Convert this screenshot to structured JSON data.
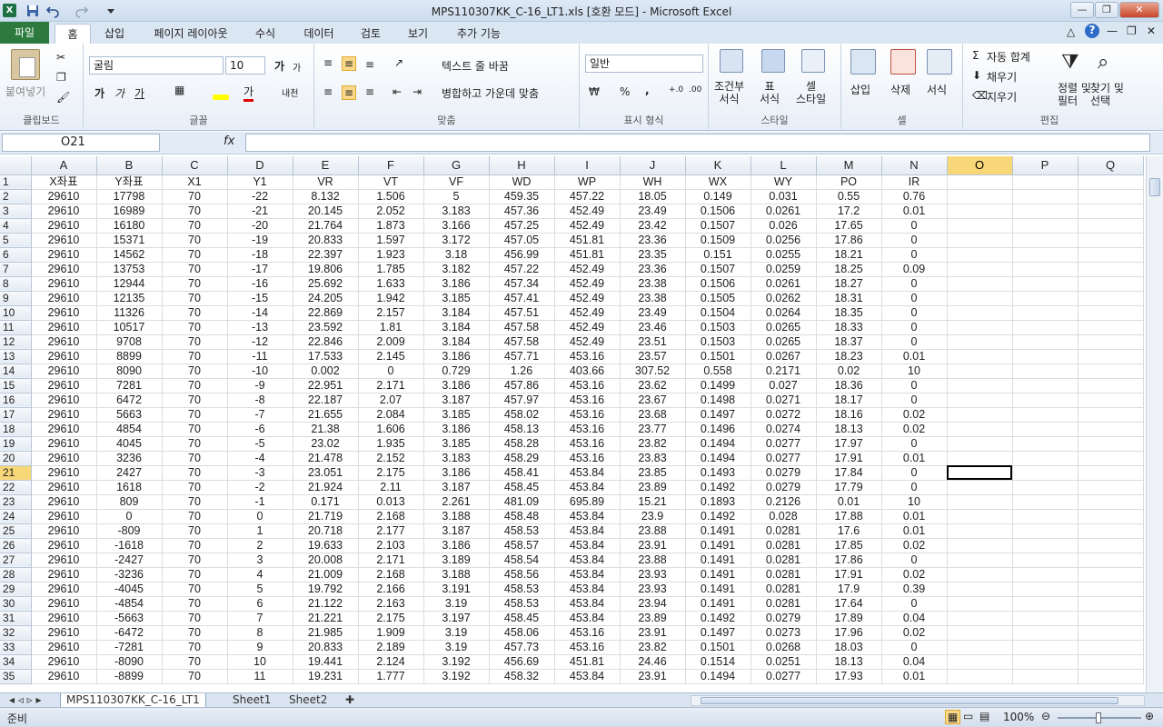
{
  "window": {
    "title": "MPS110307KK_C-16_LT1.xls  [호환 모드]  -  Microsoft Excel",
    "app_icon": "X"
  },
  "tabs": [
    "파일",
    "홈",
    "삽입",
    "페이지 레이아웃",
    "수식",
    "데이터",
    "검토",
    "보기",
    "추가 기능"
  ],
  "ribbon": {
    "clipboard": {
      "paste": "붙여넣기",
      "label": "클립보드"
    },
    "font": {
      "name": "굴림",
      "size": "10",
      "grow": "가",
      "shrink": "가",
      "bold": "가",
      "italic": "가",
      "underline": "가",
      "color_a": "가",
      "phonetic": "내천",
      "label": "글꼴"
    },
    "align": {
      "wrap": "텍스트 줄 바꿈",
      "merge": "병합하고 가운데 맞춤",
      "label": "맞춤"
    },
    "number": {
      "format": "일반",
      "percent": "%",
      "comma": ",",
      "label": "표시 형식"
    },
    "styles": {
      "cond": "조건부\n서식",
      "table": "표\n서식",
      "cell": "셀\n스타일",
      "label": "스타일"
    },
    "cells": {
      "insert": "삽입",
      "delete": "삭제",
      "format": "서식",
      "label": "셀"
    },
    "edit": {
      "autosum": "자동 합계",
      "fill": "채우기",
      "clear": "지우기",
      "sort": "정렬 및\n필터",
      "find": "찾기 및\n선택",
      "label": "편집"
    }
  },
  "formula_bar": {
    "name_box": "O21",
    "fx": "fx",
    "formula": ""
  },
  "columns": [
    "A",
    "B",
    "C",
    "D",
    "E",
    "F",
    "G",
    "H",
    "I",
    "J",
    "K",
    "L",
    "M",
    "N",
    "O",
    "P",
    "Q"
  ],
  "selected_cell": {
    "col": "O",
    "row": "21"
  },
  "rows": [
    [
      "1",
      "X좌표",
      "Y좌표",
      "X1",
      "Y1",
      "VR",
      "VT",
      "VF",
      "WD",
      "WP",
      "WH",
      "WX",
      "WY",
      "PO",
      "IR"
    ],
    [
      "2",
      "29610",
      "17798",
      "70",
      "-22",
      "8.132",
      "1.506",
      "5",
      "459.35",
      "457.22",
      "18.05",
      "0.149",
      "0.031",
      "0.55",
      "0.76"
    ],
    [
      "3",
      "29610",
      "16989",
      "70",
      "-21",
      "20.145",
      "2.052",
      "3.183",
      "457.36",
      "452.49",
      "23.49",
      "0.1506",
      "0.0261",
      "17.2",
      "0.01"
    ],
    [
      "4",
      "29610",
      "16180",
      "70",
      "-20",
      "21.764",
      "1.873",
      "3.166",
      "457.25",
      "452.49",
      "23.42",
      "0.1507",
      "0.026",
      "17.65",
      "0"
    ],
    [
      "5",
      "29610",
      "15371",
      "70",
      "-19",
      "20.833",
      "1.597",
      "3.172",
      "457.05",
      "451.81",
      "23.36",
      "0.1509",
      "0.0256",
      "17.86",
      "0"
    ],
    [
      "6",
      "29610",
      "14562",
      "70",
      "-18",
      "22.397",
      "1.923",
      "3.18",
      "456.99",
      "451.81",
      "23.35",
      "0.151",
      "0.0255",
      "18.21",
      "0"
    ],
    [
      "7",
      "29610",
      "13753",
      "70",
      "-17",
      "19.806",
      "1.785",
      "3.182",
      "457.22",
      "452.49",
      "23.36",
      "0.1507",
      "0.0259",
      "18.25",
      "0.09"
    ],
    [
      "8",
      "29610",
      "12944",
      "70",
      "-16",
      "25.692",
      "1.633",
      "3.186",
      "457.34",
      "452.49",
      "23.38",
      "0.1506",
      "0.0261",
      "18.27",
      "0"
    ],
    [
      "9",
      "29610",
      "12135",
      "70",
      "-15",
      "24.205",
      "1.942",
      "3.185",
      "457.41",
      "452.49",
      "23.38",
      "0.1505",
      "0.0262",
      "18.31",
      "0"
    ],
    [
      "10",
      "29610",
      "11326",
      "70",
      "-14",
      "22.869",
      "2.157",
      "3.184",
      "457.51",
      "452.49",
      "23.49",
      "0.1504",
      "0.0264",
      "18.35",
      "0"
    ],
    [
      "11",
      "29610",
      "10517",
      "70",
      "-13",
      "23.592",
      "1.81",
      "3.184",
      "457.58",
      "452.49",
      "23.46",
      "0.1503",
      "0.0265",
      "18.33",
      "0"
    ],
    [
      "12",
      "29610",
      "9708",
      "70",
      "-12",
      "22.846",
      "2.009",
      "3.184",
      "457.58",
      "452.49",
      "23.51",
      "0.1503",
      "0.0265",
      "18.37",
      "0"
    ],
    [
      "13",
      "29610",
      "8899",
      "70",
      "-11",
      "17.533",
      "2.145",
      "3.186",
      "457.71",
      "453.16",
      "23.57",
      "0.1501",
      "0.0267",
      "18.23",
      "0.01"
    ],
    [
      "14",
      "29610",
      "8090",
      "70",
      "-10",
      "0.002",
      "0",
      "0.729",
      "1.26",
      "403.66",
      "307.52",
      "0.558",
      "0.2171",
      "0.02",
      "10"
    ],
    [
      "15",
      "29610",
      "7281",
      "70",
      "-9",
      "22.951",
      "2.171",
      "3.186",
      "457.86",
      "453.16",
      "23.62",
      "0.1499",
      "0.027",
      "18.36",
      "0"
    ],
    [
      "16",
      "29610",
      "6472",
      "70",
      "-8",
      "22.187",
      "2.07",
      "3.187",
      "457.97",
      "453.16",
      "23.67",
      "0.1498",
      "0.0271",
      "18.17",
      "0"
    ],
    [
      "17",
      "29610",
      "5663",
      "70",
      "-7",
      "21.655",
      "2.084",
      "3.185",
      "458.02",
      "453.16",
      "23.68",
      "0.1497",
      "0.0272",
      "18.16",
      "0.02"
    ],
    [
      "18",
      "29610",
      "4854",
      "70",
      "-6",
      "21.38",
      "1.606",
      "3.186",
      "458.13",
      "453.16",
      "23.77",
      "0.1496",
      "0.0274",
      "18.13",
      "0.02"
    ],
    [
      "19",
      "29610",
      "4045",
      "70",
      "-5",
      "23.02",
      "1.935",
      "3.185",
      "458.28",
      "453.16",
      "23.82",
      "0.1494",
      "0.0277",
      "17.97",
      "0"
    ],
    [
      "20",
      "29610",
      "3236",
      "70",
      "-4",
      "21.478",
      "2.152",
      "3.183",
      "458.29",
      "453.16",
      "23.83",
      "0.1494",
      "0.0277",
      "17.91",
      "0.01"
    ],
    [
      "21",
      "29610",
      "2427",
      "70",
      "-3",
      "23.051",
      "2.175",
      "3.186",
      "458.41",
      "453.84",
      "23.85",
      "0.1493",
      "0.0279",
      "17.84",
      "0"
    ],
    [
      "22",
      "29610",
      "1618",
      "70",
      "-2",
      "21.924",
      "2.11",
      "3.187",
      "458.45",
      "453.84",
      "23.89",
      "0.1492",
      "0.0279",
      "17.79",
      "0"
    ],
    [
      "23",
      "29610",
      "809",
      "70",
      "-1",
      "0.171",
      "0.013",
      "2.261",
      "481.09",
      "695.89",
      "15.21",
      "0.1893",
      "0.2126",
      "0.01",
      "10"
    ],
    [
      "24",
      "29610",
      "0",
      "70",
      "0",
      "21.719",
      "2.168",
      "3.188",
      "458.48",
      "453.84",
      "23.9",
      "0.1492",
      "0.028",
      "17.88",
      "0.01"
    ],
    [
      "25",
      "29610",
      "-809",
      "70",
      "1",
      "20.718",
      "2.177",
      "3.187",
      "458.53",
      "453.84",
      "23.88",
      "0.1491",
      "0.0281",
      "17.6",
      "0.01"
    ],
    [
      "26",
      "29610",
      "-1618",
      "70",
      "2",
      "19.633",
      "2.103",
      "3.186",
      "458.57",
      "453.84",
      "23.91",
      "0.1491",
      "0.0281",
      "17.85",
      "0.02"
    ],
    [
      "27",
      "29610",
      "-2427",
      "70",
      "3",
      "20.008",
      "2.171",
      "3.189",
      "458.54",
      "453.84",
      "23.88",
      "0.1491",
      "0.0281",
      "17.86",
      "0"
    ],
    [
      "28",
      "29610",
      "-3236",
      "70",
      "4",
      "21.009",
      "2.168",
      "3.188",
      "458.56",
      "453.84",
      "23.93",
      "0.1491",
      "0.0281",
      "17.91",
      "0.02"
    ],
    [
      "29",
      "29610",
      "-4045",
      "70",
      "5",
      "19.792",
      "2.166",
      "3.191",
      "458.53",
      "453.84",
      "23.93",
      "0.1491",
      "0.0281",
      "17.9",
      "0.39"
    ],
    [
      "30",
      "29610",
      "-4854",
      "70",
      "6",
      "21.122",
      "2.163",
      "3.19",
      "458.53",
      "453.84",
      "23.94",
      "0.1491",
      "0.0281",
      "17.64",
      "0"
    ],
    [
      "31",
      "29610",
      "-5663",
      "70",
      "7",
      "21.221",
      "2.175",
      "3.197",
      "458.45",
      "453.84",
      "23.89",
      "0.1492",
      "0.0279",
      "17.89",
      "0.04"
    ],
    [
      "32",
      "29610",
      "-6472",
      "70",
      "8",
      "21.985",
      "1.909",
      "3.19",
      "458.06",
      "453.16",
      "23.91",
      "0.1497",
      "0.0273",
      "17.96",
      "0.02"
    ],
    [
      "33",
      "29610",
      "-7281",
      "70",
      "9",
      "20.833",
      "2.189",
      "3.19",
      "457.73",
      "453.16",
      "23.82",
      "0.1501",
      "0.0268",
      "18.03",
      "0"
    ],
    [
      "34",
      "29610",
      "-8090",
      "70",
      "10",
      "19.441",
      "2.124",
      "3.192",
      "456.69",
      "451.81",
      "24.46",
      "0.1514",
      "0.0251",
      "18.13",
      "0.04"
    ],
    [
      "35",
      "29610",
      "-8899",
      "70",
      "11",
      "19.231",
      "1.777",
      "3.192",
      "458.32",
      "453.84",
      "23.91",
      "0.1494",
      "0.0277",
      "17.93",
      "0.01"
    ]
  ],
  "sheets": [
    "MPS110307KK_C-16_LT1",
    "Sheet1",
    "Sheet2"
  ],
  "status": {
    "ready": "준비",
    "zoom": "100%"
  },
  "colors": {
    "file_tab": "#2c7a3e",
    "selected_header": "#f8d779",
    "ribbon_bg": "#e7eef7"
  }
}
